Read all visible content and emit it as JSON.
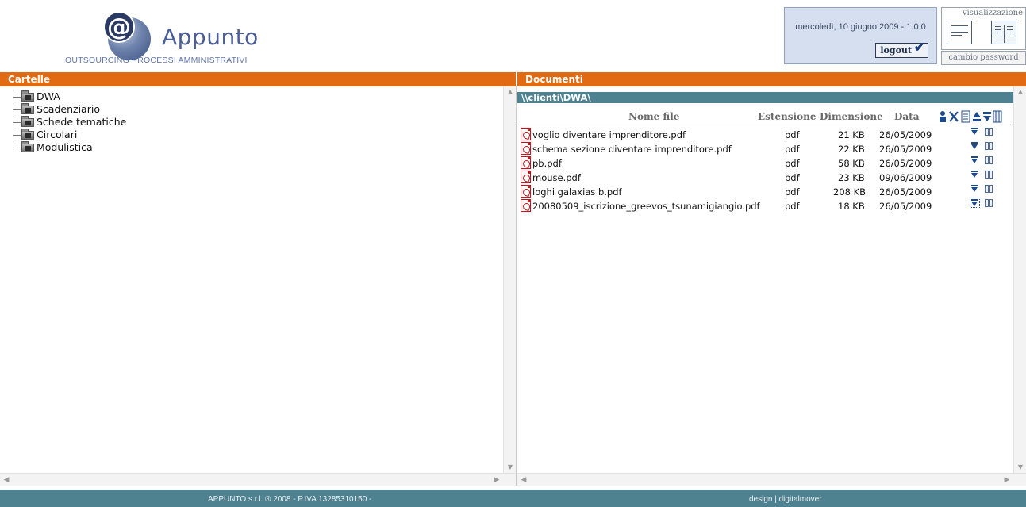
{
  "header": {
    "logo_name": "Appunto",
    "logo_tagline": "OUTSOURCING PROCESSI AMMINISTRATIVI",
    "user_date": "mercoledì, 10 giugno 2009 - 1.0.0",
    "logout_label": "logout",
    "view_label": "visualizzazione",
    "change_password_label": "cambio password"
  },
  "left_panel": {
    "title": "Cartelle",
    "folders": [
      "DWA",
      "Scadenziario",
      "Schede tematiche",
      "Circolari",
      "Modulistica"
    ]
  },
  "right_panel": {
    "title": "Documenti",
    "path": "\\\\clienti\\DWA\\",
    "columns": {
      "name": "Nome file",
      "extension": "Estensione",
      "size": "Dimensione",
      "date": "Data"
    },
    "files": [
      {
        "name": "voglio diventare imprenditore.pdf",
        "ext": "pdf",
        "size": "21 KB",
        "date": "26/05/2009"
      },
      {
        "name": "schema sezione diventare imprenditore.pdf",
        "ext": "pdf",
        "size": "22 KB",
        "date": "26/05/2009"
      },
      {
        "name": "pb.pdf",
        "ext": "pdf",
        "size": "58 KB",
        "date": "26/05/2009"
      },
      {
        "name": "mouse.pdf",
        "ext": "pdf",
        "size": "23 KB",
        "date": "09/06/2009"
      },
      {
        "name": "loghi galaxias b.pdf",
        "ext": "pdf",
        "size": "208 KB",
        "date": "26/05/2009"
      },
      {
        "name": "20080509_iscrizione_greevos_tsunamigiangio.pdf",
        "ext": "pdf",
        "size": "18 KB",
        "date": "26/05/2009"
      }
    ]
  },
  "footer": {
    "left": "APPUNTO s.r.l. ® 2008 - P.IVA 13285310150 -",
    "right": "design | digitalmover"
  },
  "colors": {
    "orange_bar": "#e26a12",
    "teal_bar": "#4e8291",
    "user_box": "#d5dfef"
  },
  "icons": [
    "logo-at-icon",
    "folder-icon",
    "pdf-icon",
    "download-icon",
    "view-file-icon",
    "upload-icon",
    "delete-icon",
    "properties-icon",
    "logout-check-icon",
    "list-view-icon",
    "columns-view-icon"
  ]
}
